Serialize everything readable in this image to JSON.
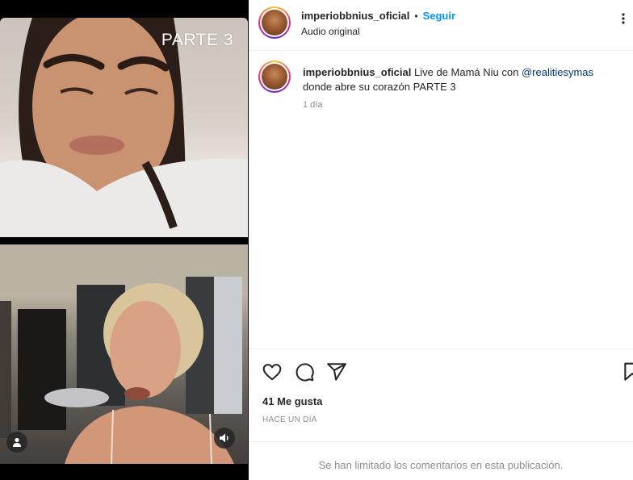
{
  "video": {
    "overlay_label": "PARTE 3"
  },
  "header": {
    "username": "imperiobbnius_oficial",
    "separator": "•",
    "follow_label": "Seguir",
    "audio_label": "Audio original",
    "more_label": "⋮",
    "avatar_icon": "profile-avatar"
  },
  "caption": {
    "username": "imperiobbnius_oficial",
    "text_before": "Live de Mamá Niu con",
    "mention": "@realitiesymas",
    "text_after": "donde abre su corazón PARTE 3",
    "time": "1 día"
  },
  "actions": {
    "icons": [
      "heart-icon",
      "comment-icon",
      "share-icon",
      "bookmark-icon"
    ],
    "likes": "41 Me gusta",
    "date": "HACE UN DÍA"
  },
  "comments": {
    "limited_text": "Se han limitado los comentarios en esta publicación."
  }
}
